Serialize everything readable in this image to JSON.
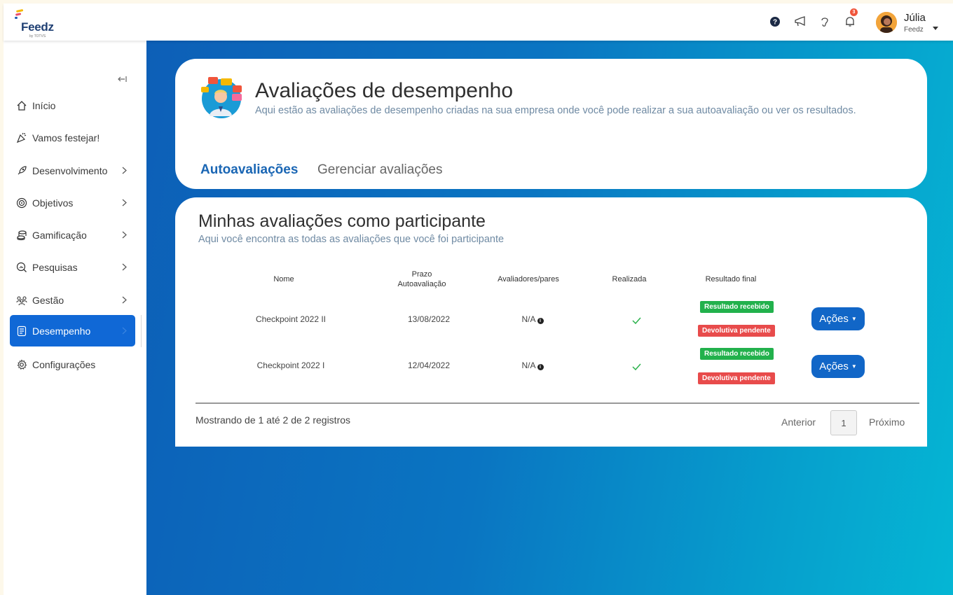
{
  "app": {
    "logo_text": "Feedz",
    "logo_sub": "by TOTVS"
  },
  "topbar": {
    "notification_count": "3",
    "user": {
      "name": "Júlia",
      "company": "Feedz"
    }
  },
  "sidebar": {
    "items": [
      {
        "label": "Início"
      },
      {
        "label": "Vamos festejar!"
      },
      {
        "label": "Desenvolvimento"
      },
      {
        "label": "Objetivos"
      },
      {
        "label": "Gamificação"
      },
      {
        "label": "Pesquisas"
      },
      {
        "label": "Gestão"
      },
      {
        "label": "Desempenho"
      },
      {
        "label": "Configurações"
      }
    ],
    "active": "Desempenho"
  },
  "header": {
    "title": "Avaliações de desempenho",
    "subtitle": "Aqui estão as avaliações de desempenho criadas na sua empresa onde você pode realizar a sua autoavaliação ou ver os resultados.",
    "tabs": [
      {
        "label": "Autoavaliações",
        "active": true
      },
      {
        "label": "Gerenciar avaliações",
        "active": false
      }
    ]
  },
  "section": {
    "title": "Minhas avaliações como participante",
    "subtitle": "Aqui você encontra as todas as avaliações que você foi participante"
  },
  "table": {
    "columns": {
      "nome": "Nome",
      "prazo_line1": "Prazo",
      "prazo_line2": "Autoavaliação",
      "avaliadores": "Avaliadores/pares",
      "realizada": "Realizada",
      "resultado": "Resultado final"
    },
    "rows": [
      {
        "nome": "Checkpoint 2022 II",
        "prazo": "13/08/2022",
        "avaliadores": "N/A",
        "realizada": true,
        "resultado_tags": [
          "Resultado recebido",
          "Devolutiva pendente"
        ],
        "acao": "Ações"
      },
      {
        "nome": "Checkpoint 2022 I",
        "prazo": "12/04/2022",
        "avaliadores": "N/A",
        "realizada": true,
        "resultado_tags": [
          "Resultado recebido",
          "Devolutiva pendente"
        ],
        "acao": "Ações"
      }
    ],
    "footer": "Mostrando de 1 até 2 de 2 registros",
    "pagination": {
      "prev": "Anterior",
      "page": "1",
      "next": "Próximo"
    }
  },
  "colors": {
    "brand_blue": "#1068d6",
    "tab_active": "#1a66b4",
    "tag_green": "#22b14c",
    "tag_red": "#e84b4b",
    "button_blue": "#1166c7"
  }
}
